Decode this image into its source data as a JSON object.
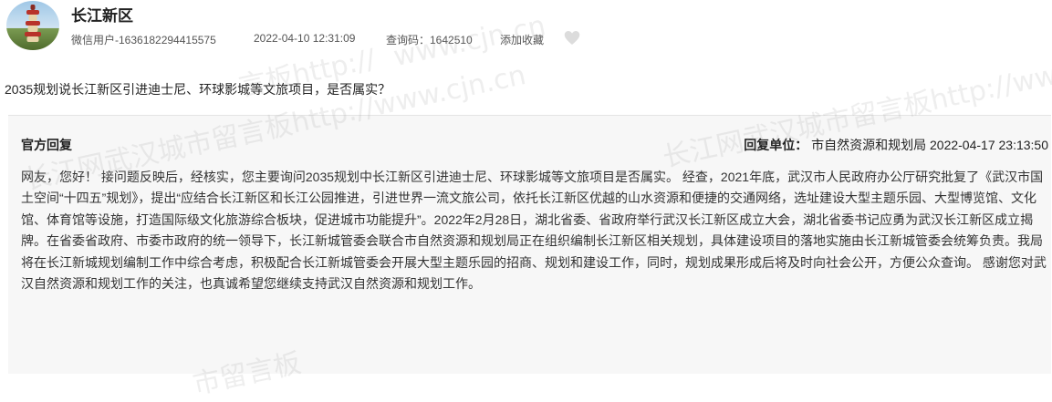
{
  "header": {
    "title": "长江新区",
    "user": "微信用户-1636182294415575",
    "datetime": "2022-04-10 12:31:09",
    "query_code": "查询码：1642510",
    "favorite_label": "添加收藏",
    "heart_icon": "heart-icon"
  },
  "question": "2035规划说长江新区引进迪士尼、环球影城等文旅项目，是否属实？",
  "reply": {
    "title": "官方回复",
    "unit_label": "回复单位：",
    "unit_name": "市自然资源和规划局",
    "datetime": "2022-04-17 23:13:50",
    "body": "网友，您好！ 接问题反映后，经核实，您主要询问2035规划中长江新区引进迪士尼、环球影城等文旅项目是否属实。 经查，2021年底，武汉市人民政府办公厅研究批复了《武汉市国土空间“十四五”规划》，提出“应结合长江新区和长江公园推进，引进世界一流文旅公司，依托长江新区优越的山水资源和便捷的交通网络，选址建设大型主题乐园、大型博览馆、文化馆、体育馆等设施，打造国际级文化旅游综合板块，促进城市功能提升”。2022年2月28日，湖北省委、省政府举行武汉长江新区成立大会，湖北省委书记应勇为武汉长江新区成立揭牌。在省委省政府、市委市政府的统一领导下，长江新城管委会联合市自然资源和规划局正在组织编制长江新区相关规划，具体建设项目的落地实施由长江新城管委会统筹负责。我局将在长江新城规划编制工作中综合考虑，积极配合长江新城管委会开展大型主题乐园的招商、规划和建设工作，同时，规划成果形成后将及时向社会公开，方便公众查询。 感谢您对武汉自然资源和规划工作的关注，也真诚希望您继续支持武汉自然资源和规划工作。"
  },
  "watermarks": {
    "w1": "www.cjn.cn",
    "w2": "长江网武汉城市留言板http://www.cjn.cn",
    "w3": "长江网武汉城市留言板http://www.cjn.cn",
    "w4": "言板http://",
    "w5": "市留言板"
  },
  "colors": {
    "text": "#333333",
    "reply_bg": "#f7f7f7",
    "heart": "#dddddd"
  }
}
